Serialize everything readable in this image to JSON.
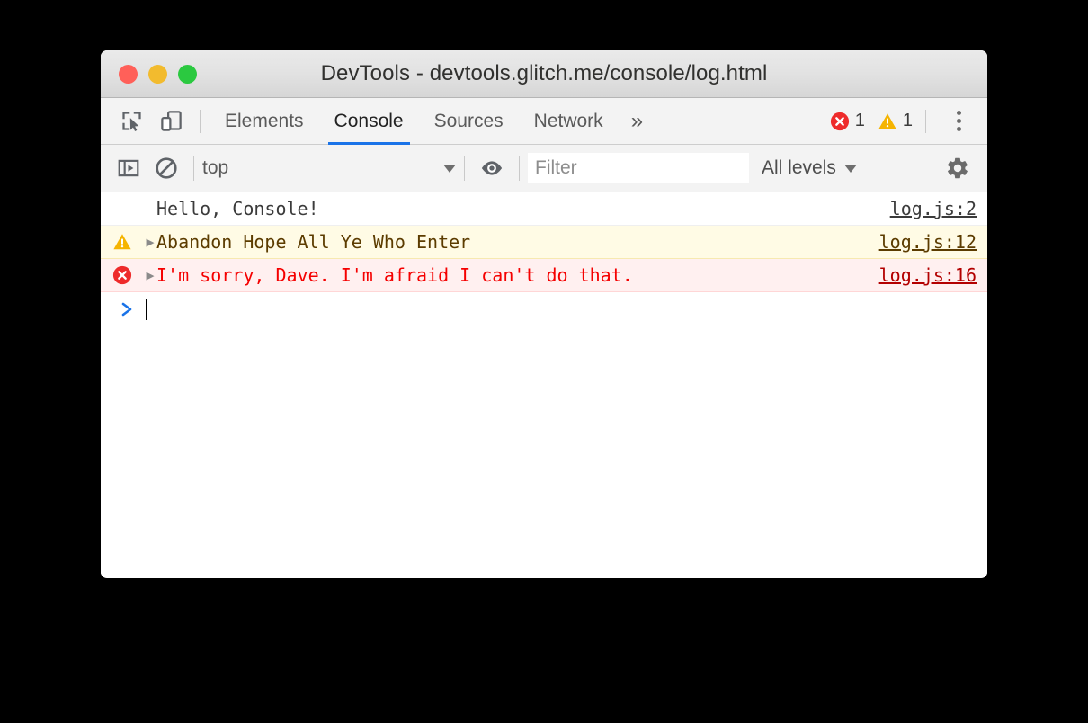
{
  "window": {
    "title": "DevTools - devtools.glitch.me/console/log.html",
    "traffic_lights": [
      {
        "name": "close",
        "color": "#ff6059"
      },
      {
        "name": "minimize",
        "color": "#f2bb2e"
      },
      {
        "name": "zoom",
        "color": "#2bc940"
      }
    ]
  },
  "tabbar": {
    "icons": [
      {
        "name": "inspect-element-icon"
      },
      {
        "name": "device-toolbar-icon"
      }
    ],
    "tabs": [
      {
        "label": "Elements",
        "active": false
      },
      {
        "label": "Console",
        "active": true
      },
      {
        "label": "Sources",
        "active": false
      },
      {
        "label": "Network",
        "active": false
      }
    ],
    "overflow_label": "»",
    "error_count": "1",
    "warning_count": "1",
    "menu_icon": "kebab-menu-icon"
  },
  "console_toolbar": {
    "sidebar_toggle_icon": "console-sidebar-icon",
    "clear_console_icon": "clear-console-icon",
    "context": {
      "value": "top"
    },
    "live_expression_icon": "eye-icon",
    "filter": {
      "value": "",
      "placeholder": "Filter"
    },
    "levels": {
      "label": "All levels"
    },
    "settings_icon": "gear-icon"
  },
  "console_messages": [
    {
      "level": "log",
      "has_icon": false,
      "has_arrow": false,
      "text": "Hello, Console!",
      "source": "log.js:2"
    },
    {
      "level": "warn",
      "has_icon": true,
      "has_arrow": true,
      "arrow": "▶",
      "text": "Abandon Hope All Ye Who Enter",
      "source": "log.js:12"
    },
    {
      "level": "error",
      "has_icon": true,
      "has_arrow": true,
      "arrow": "▶",
      "text": "I'm sorry, Dave. I'm afraid I can't do that.",
      "source": "log.js:16"
    }
  ],
  "prompt": {
    "chevron": "prompt-chevron-icon",
    "value": ""
  },
  "colors": {
    "accent": "#1a73e8",
    "error": "#ee2b2b",
    "warning": "#f5b400",
    "warn_bg": "#fffbe5",
    "error_bg": "#fff0f0"
  }
}
